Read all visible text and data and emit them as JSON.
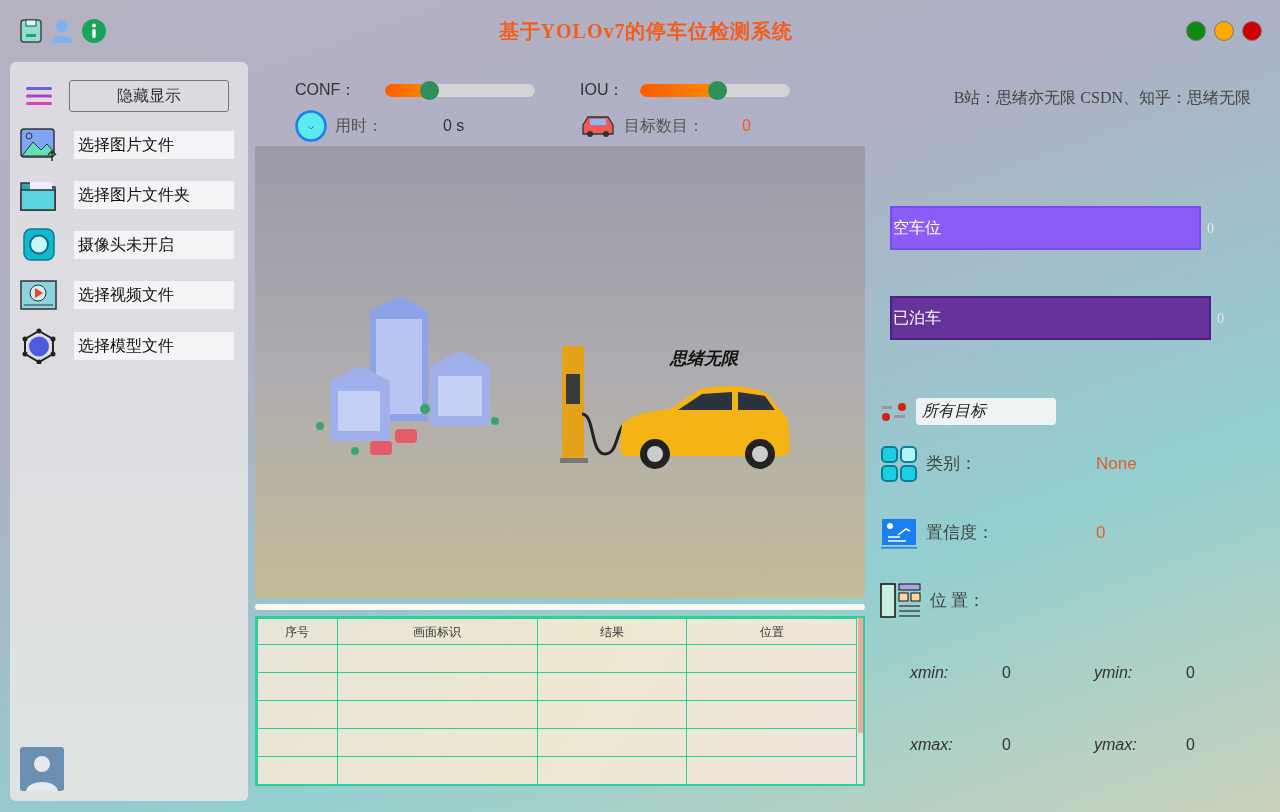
{
  "window": {
    "title": "基于YOLOv7的停车位检测系统"
  },
  "sidebar": {
    "toggle": {
      "label": "隐藏显示"
    },
    "items": [
      {
        "label": "选择图片文件"
      },
      {
        "label": "选择图片文件夹"
      },
      {
        "label": "摄像头未开启"
      },
      {
        "label": "选择视频文件"
      },
      {
        "label": "选择模型文件"
      }
    ]
  },
  "sliders": [
    {
      "label": "CONF：",
      "level": 0.29
    },
    {
      "label": "IOU：",
      "level": 0.51
    }
  ],
  "stats": [
    {
      "label": "用时：",
      "value": "0 s"
    },
    {
      "label": "目标数目：",
      "value": "0"
    }
  ],
  "display": {
    "caption": "思绪无限"
  },
  "table": {
    "columns": [
      "序号",
      "画面标识",
      "结果",
      "位置"
    ]
  },
  "credit": "B站：思绪亦无限  CSDN、知乎：思绪无限",
  "counts": [
    {
      "label": "空车位",
      "value": "0",
      "color": "#8b5cf6"
    },
    {
      "label": "已泊车",
      "value": "0",
      "color": "#663399"
    }
  ],
  "target_filter": {
    "value": "所有目标"
  },
  "details": [
    {
      "label": "类别：",
      "value": "None"
    },
    {
      "label": "置信度：",
      "value": "0"
    },
    {
      "label": "位 置："
    }
  ],
  "coords": [
    {
      "label": "xmin:",
      "value": "0"
    },
    {
      "label": "ymin:",
      "value": "0"
    },
    {
      "label": "xmax:",
      "value": "0"
    },
    {
      "label": "ymax:",
      "value": "0"
    }
  ]
}
